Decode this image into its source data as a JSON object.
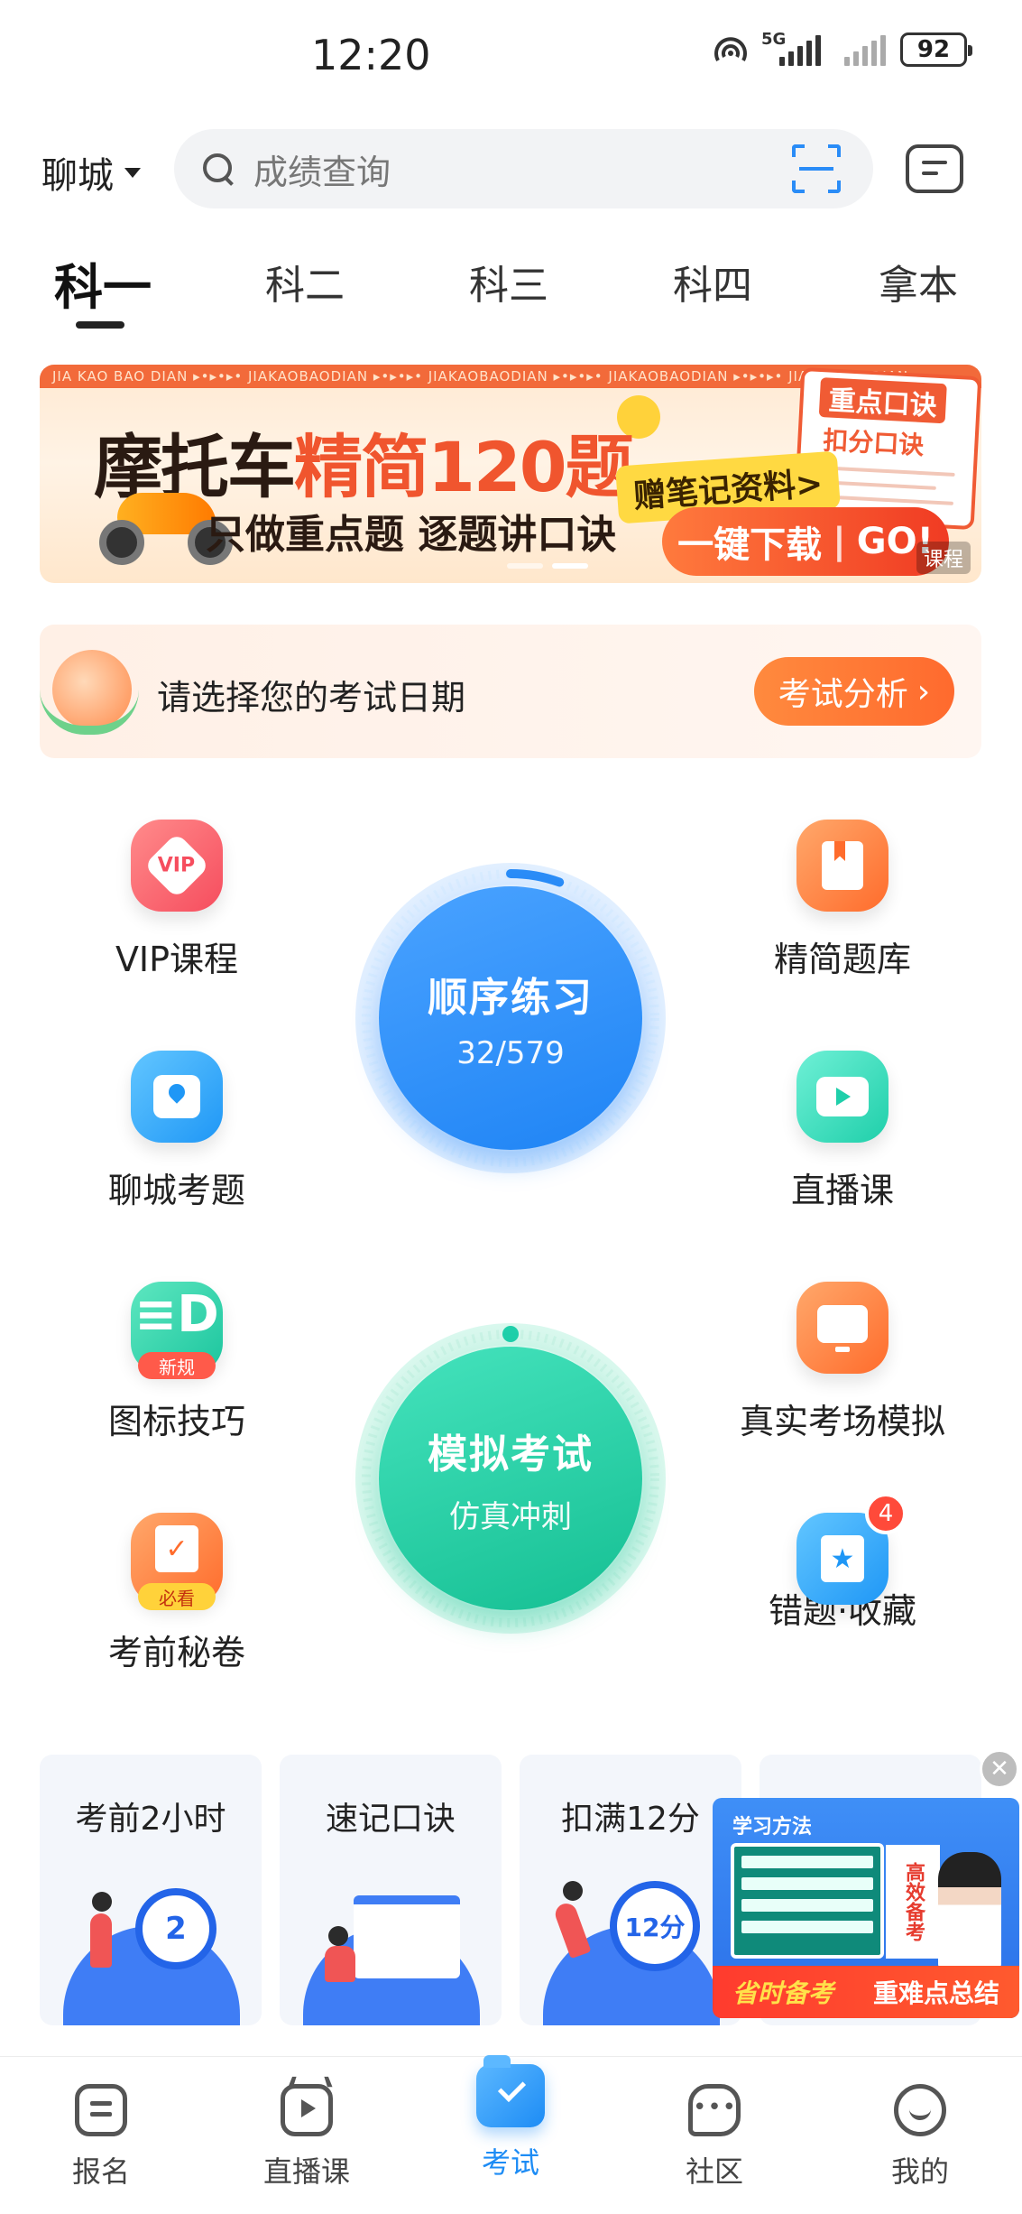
{
  "status_bar": {
    "time": "12:20",
    "network": "5G",
    "battery": "92"
  },
  "header": {
    "city": "聊城",
    "search_placeholder": "成绩查询"
  },
  "subject_tabs": [
    "科一",
    "科二",
    "科三",
    "科四",
    "拿本"
  ],
  "banner": {
    "strip_text": "JIA KAO BAO DIAN  ▸•▸•▸•  JIAKAOBAODIAN  ▸•▸•▸•  JIAKAOBAODIAN  ▸•▸•▸•  JIAKAOBAODIAN  ▸•▸•▸•  JIAKAOBAODIAN",
    "title_prefix": "摩托车",
    "title_highlight": "精简120题",
    "subtitle": "只做重点题 逐题讲口诀",
    "gift_label": "赠笔记资料>",
    "card_title": "重点口诀",
    "card_subtitle": "扣分口诀",
    "button_left": "一键下载",
    "button_right": "GO!",
    "ad_tag": "课程"
  },
  "exam_date": {
    "prompt": "请选择您的考试日期",
    "action": "考试分析"
  },
  "features": {
    "vip": "VIP课程",
    "vip_badge": "VIP",
    "question_bank": "精简题库",
    "local_questions": "聊城考题",
    "live_class": "直播课",
    "sign_tips": "图标技巧",
    "sign_tips_tag": "新规",
    "real_exam_sim": "真实考场模拟",
    "secret_paper": "考前秘卷",
    "secret_paper_tag": "必看",
    "mistakes_favorites": "错题·收藏",
    "mistakes_badge": "4"
  },
  "practice": {
    "title": "顺序练习",
    "progress_text": "32/579",
    "progress": 0.055
  },
  "mock_exam": {
    "title": "模拟考试",
    "subtitle": "仿真冲刺"
  },
  "quick_cards": [
    {
      "title": "考前2小时",
      "art": "2"
    },
    {
      "title": "速记口诀",
      "art": ""
    },
    {
      "title": "扣满12分",
      "art": "12分"
    },
    {
      "title": "",
      "art": ""
    }
  ],
  "video_ad": {
    "header": "学习方法",
    "side_text": "高效备考",
    "footer_left": "省时备考",
    "footer_right": "重难点总结"
  },
  "bottom_nav": [
    {
      "label": "报名",
      "icon": "document-icon"
    },
    {
      "label": "直播课",
      "icon": "tv-icon"
    },
    {
      "label": "考试",
      "icon": "exam-folder-icon",
      "active": true
    },
    {
      "label": "社区",
      "icon": "chat-icon"
    },
    {
      "label": "我的",
      "icon": "profile-icon"
    }
  ],
  "colors": {
    "primary_blue": "#1d8cf5",
    "accent_orange": "#ff6a2e",
    "mint": "#1fcfaa"
  }
}
